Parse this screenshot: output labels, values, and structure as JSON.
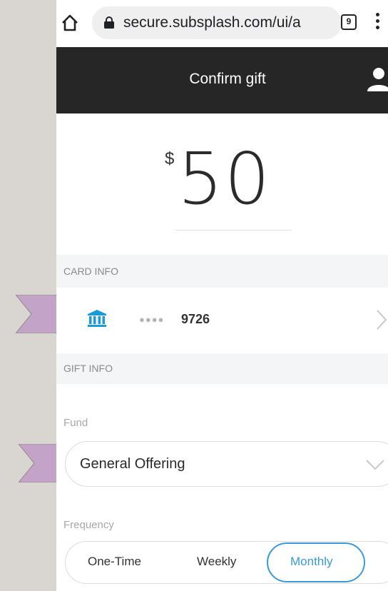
{
  "browser": {
    "url": "secure.subsplash.com/ui/a",
    "tab_count": "9"
  },
  "header": {
    "title": "Confirm gift"
  },
  "amount": {
    "currency": "$",
    "value": "50"
  },
  "card_info": {
    "section_label": "CARD INFO",
    "masked": "●●●●",
    "last4": "9726",
    "icon": "bank-icon"
  },
  "gift_info": {
    "section_label": "GIFT INFO",
    "fund_label": "Fund",
    "fund_value": "General Offering",
    "frequency_label": "Frequency",
    "frequency_options": [
      "One-Time",
      "Weekly",
      "Monthly"
    ],
    "frequency_selected": "Monthly"
  },
  "colors": {
    "header_bg": "#262626",
    "accent_blue": "#1a9bd7",
    "selected_outline": "#3a9ad9",
    "pointer": "#c4a3c8"
  }
}
